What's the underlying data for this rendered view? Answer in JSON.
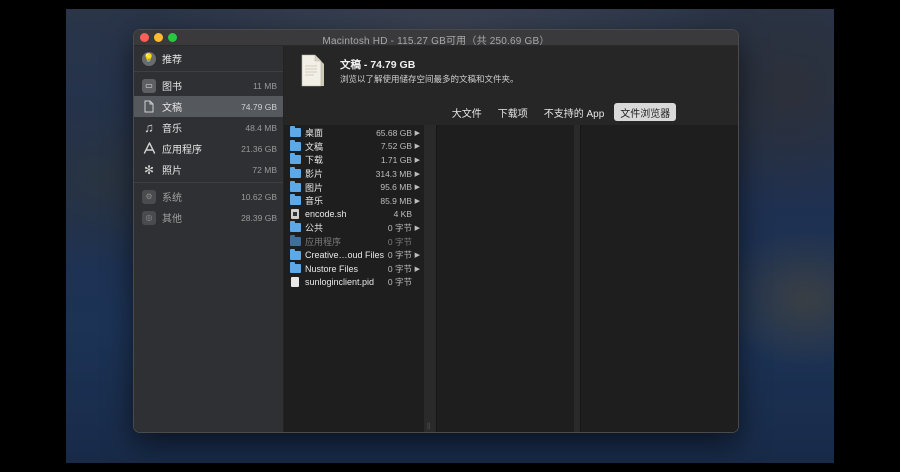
{
  "window": {
    "title": "Macintosh HD - 115.27 GB可用（共 250.69 GB）"
  },
  "sidebar": {
    "top": {
      "label": "推荐",
      "icon": "lightbulb-icon"
    },
    "items": [
      {
        "label": "图书",
        "size": "11 MB",
        "icon": "book-icon"
      },
      {
        "label": "文稿",
        "size": "74.79 GB",
        "icon": "document-icon"
      },
      {
        "label": "音乐",
        "size": "48.4 MB",
        "icon": "music-note-icon"
      },
      {
        "label": "应用程序",
        "size": "21.36 GB",
        "icon": "app-store-icon"
      },
      {
        "label": "照片",
        "size": "72 MB",
        "icon": "photos-icon"
      }
    ],
    "system": [
      {
        "label": "系统",
        "size": "10.62 GB",
        "icon": "gear-icon"
      },
      {
        "label": "其他",
        "size": "28.39 GB",
        "icon": "other-icon"
      }
    ]
  },
  "header": {
    "title": "文稿 - 74.79 GB",
    "subtitle": "浏览以了解使用储存空间最多的文稿和文件夹。"
  },
  "tabs": [
    {
      "label": "大文件",
      "active": false
    },
    {
      "label": "下载项",
      "active": false
    },
    {
      "label": "不支持的 App",
      "active": false
    },
    {
      "label": "文件浏览器",
      "active": true
    }
  ],
  "files": [
    {
      "name": "桌面",
      "size": "65.68 GB",
      "type": "folder",
      "arrow": "▶",
      "dim": false
    },
    {
      "name": "文稿",
      "size": "7.52 GB",
      "type": "folder",
      "arrow": "▶",
      "dim": false
    },
    {
      "name": "下载",
      "size": "1.71 GB",
      "type": "folder",
      "arrow": "▶",
      "dim": false
    },
    {
      "name": "影片",
      "size": "314.3 MB",
      "type": "folder",
      "arrow": "▶",
      "dim": false
    },
    {
      "name": "图片",
      "size": "95.6 MB",
      "type": "folder",
      "arrow": "▶",
      "dim": false
    },
    {
      "name": "音乐",
      "size": "85.9 MB",
      "type": "folder",
      "arrow": "▶",
      "dim": false
    },
    {
      "name": "encode.sh",
      "size": "4 KB",
      "type": "script",
      "arrow": "",
      "dim": false
    },
    {
      "name": "公共",
      "size": "0 字节",
      "type": "folder",
      "arrow": "▶",
      "dim": false
    },
    {
      "name": "应用程序",
      "size": "0 字节",
      "type": "folder",
      "arrow": "",
      "dim": true
    },
    {
      "name": "Creative…oud Files",
      "size": "0 字节",
      "type": "folder",
      "arrow": "▶",
      "dim": false
    },
    {
      "name": "Nustore Files",
      "size": "0 字节",
      "type": "folder",
      "arrow": "▶",
      "dim": false
    },
    {
      "name": "sunloginclient.pid",
      "size": "0 字节",
      "type": "file",
      "arrow": "",
      "dim": false
    }
  ]
}
